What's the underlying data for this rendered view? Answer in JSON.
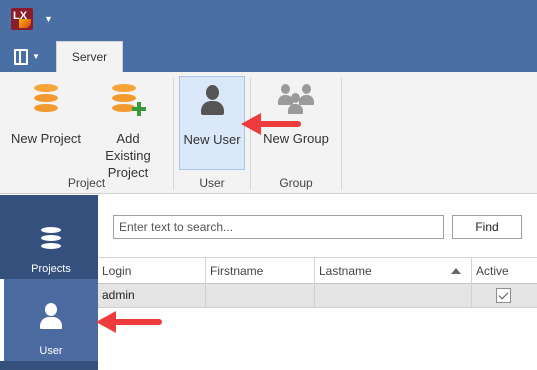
{
  "titlebar": {
    "app_logo_text": "LX",
    "accent": "#4a6fa5"
  },
  "tabs": [
    {
      "label": "Server",
      "active": true
    }
  ],
  "ribbon": {
    "buttons": [
      {
        "id": "new-project",
        "label": "New Project",
        "icon": "database-icon"
      },
      {
        "id": "add-existing-project",
        "label": "Add Existing Project",
        "icon": "database-add-icon"
      },
      {
        "id": "new-user",
        "label": "New User",
        "icon": "user-icon",
        "selected": true
      },
      {
        "id": "new-group",
        "label": "New Group",
        "icon": "group-icon"
      }
    ],
    "groups": [
      {
        "label": "Project"
      },
      {
        "label": "User"
      },
      {
        "label": "Group"
      }
    ]
  },
  "nav": {
    "items": [
      {
        "label": "Projects",
        "icon": "database-icon",
        "active": false
      },
      {
        "label": "User",
        "icon": "user-icon",
        "active": true
      }
    ],
    "color": "#35507d"
  },
  "search": {
    "placeholder": "Enter text to search...",
    "value": "",
    "button_label": "Find"
  },
  "grid": {
    "columns": [
      "Login",
      "Firstname",
      "Lastname",
      "Active"
    ],
    "sorted_column": "Lastname",
    "sort_direction": "ascending",
    "rows": [
      {
        "login": "admin",
        "firstname": "",
        "lastname": "",
        "active": true
      }
    ]
  },
  "annotation_color": "#ee3b3b"
}
